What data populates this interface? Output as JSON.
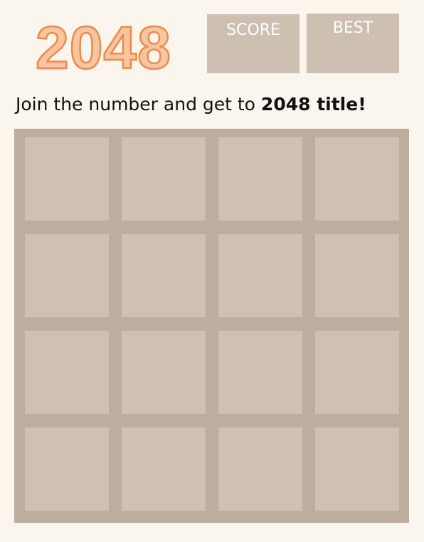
{
  "header": {
    "logo_text": "2048",
    "score_label": "SCORE",
    "score_value": "",
    "best_label": "BEST",
    "best_value": ""
  },
  "tagline": {
    "text": "Join the number and get to ",
    "emphasis": "2048 title!"
  },
  "board": {
    "rows": 4,
    "cols": 4,
    "cells": [
      [
        "",
        "",
        "",
        ""
      ],
      [
        "",
        "",
        "",
        ""
      ],
      [
        "",
        "",
        "",
        ""
      ],
      [
        "",
        "",
        "",
        ""
      ]
    ]
  },
  "colors": {
    "background": "#faf6ee",
    "logo_fill": "#f9c5a1",
    "logo_outline": "#ec8b4a",
    "score_box": "#cdbfb1",
    "board": "#bdad9e",
    "empty_cell": "#cec0b2"
  }
}
